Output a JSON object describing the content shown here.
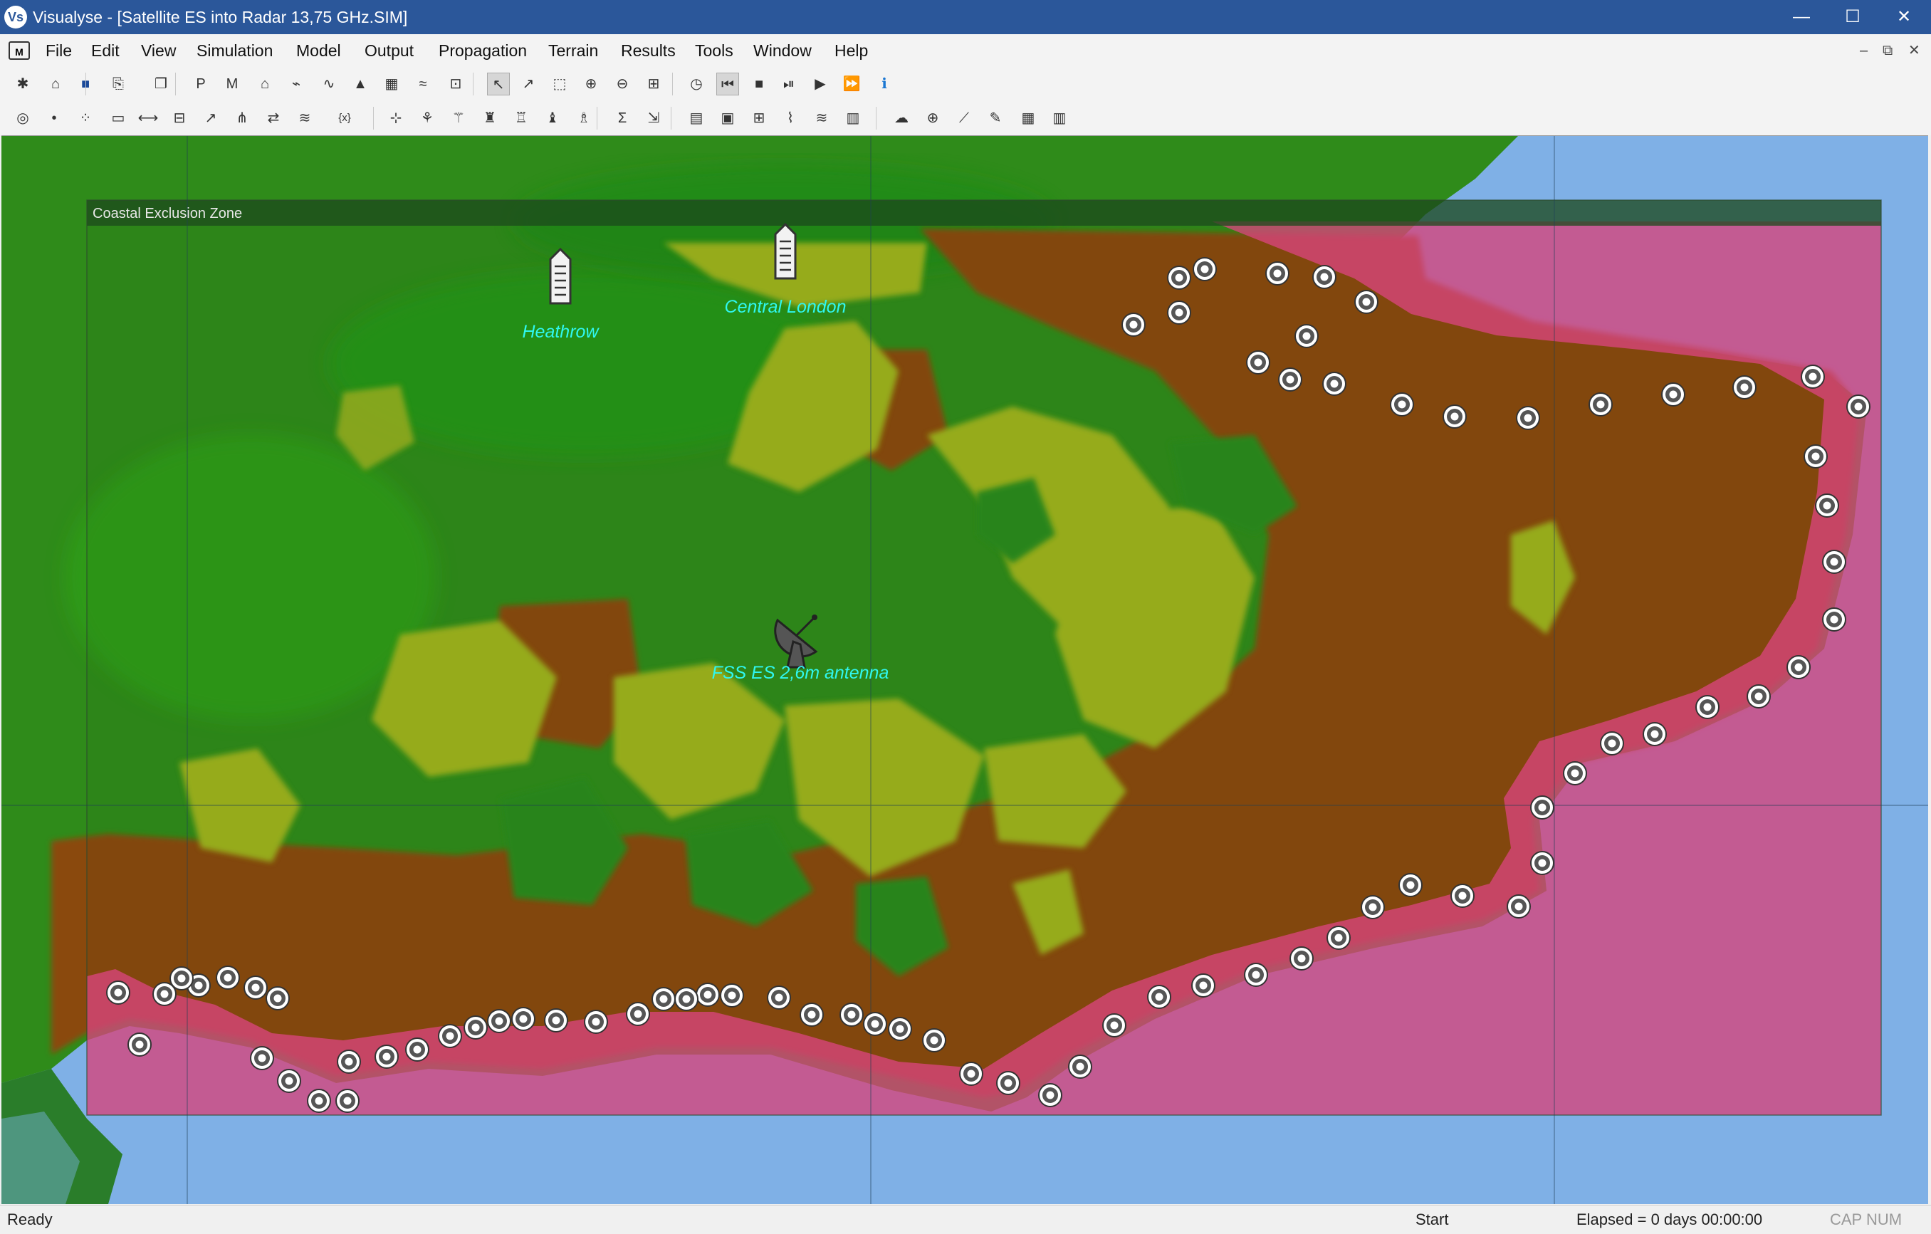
{
  "window": {
    "app_icon_text": "Vs",
    "title": "Visualyse - [Satellite ES into Radar 13,75 GHz.SIM]",
    "minimize_glyph": "—",
    "maximize_glyph": "☐",
    "close_glyph": "✕"
  },
  "menubar": {
    "doc_icon_text": "M",
    "items": [
      "File",
      "Edit",
      "View",
      "Simulation",
      "Model",
      "Output",
      "Propagation",
      "Terrain",
      "Results",
      "Tools",
      "Window",
      "Help"
    ],
    "mdi_minimize": "–",
    "mdi_restore": "⧉",
    "mdi_close": "✕"
  },
  "toolbar1": {
    "icons": [
      {
        "name": "new-file-icon",
        "glyph": "✱"
      },
      {
        "name": "open-file-icon",
        "glyph": "⌂"
      },
      {
        "name": "save-icon",
        "glyph": "■"
      },
      {
        "name": "save-as-icon",
        "glyph": "⎘"
      },
      {
        "name": "copy-icon",
        "glyph": "❐"
      },
      {
        "name": "station-p-icon",
        "glyph": "P"
      },
      {
        "name": "station-m-icon",
        "glyph": "M"
      },
      {
        "name": "station-earth-icon",
        "glyph": "⌂"
      },
      {
        "name": "station-link-icon",
        "glyph": "⌁"
      },
      {
        "name": "station-orbit-icon",
        "glyph": "∿"
      },
      {
        "name": "terrain-profile-icon",
        "glyph": "▲"
      },
      {
        "name": "table-icon",
        "glyph": "▦"
      },
      {
        "name": "area-analysis-icon",
        "glyph": "≈"
      },
      {
        "name": "map-view-icon",
        "glyph": "⊡"
      },
      {
        "name": "select-pointer-icon",
        "glyph": "↖"
      },
      {
        "name": "select-multi-icon",
        "glyph": "↗"
      },
      {
        "name": "select-area-icon",
        "glyph": "⬚"
      },
      {
        "name": "zoom-in-icon",
        "glyph": "⊕"
      },
      {
        "name": "zoom-out-icon",
        "glyph": "⊖"
      },
      {
        "name": "zoom-100-icon",
        "glyph": "⊞"
      },
      {
        "name": "clock-icon",
        "glyph": "◷"
      },
      {
        "name": "rewind-icon",
        "glyph": "⏮"
      },
      {
        "name": "stop-icon",
        "glyph": "■"
      },
      {
        "name": "step-icon",
        "glyph": "⏯"
      },
      {
        "name": "play-icon",
        "glyph": "▶"
      },
      {
        "name": "fast-forward-icon",
        "glyph": "⏩"
      },
      {
        "name": "info-icon",
        "glyph": "ℹ"
      }
    ]
  },
  "toolbar2": {
    "icons": [
      {
        "name": "antenna-icon",
        "glyph": "◎"
      },
      {
        "name": "point-icon",
        "glyph": "•"
      },
      {
        "name": "point-grid-icon",
        "glyph": "⁘"
      },
      {
        "name": "area-rect-icon",
        "glyph": "▭"
      },
      {
        "name": "line-icon",
        "glyph": "⟷"
      },
      {
        "name": "link-bracket-icon",
        "glyph": "⊟"
      },
      {
        "name": "beam-icon",
        "glyph": "↗"
      },
      {
        "name": "network-icon",
        "glyph": "⋔"
      },
      {
        "name": "swap-icon",
        "glyph": "⇄"
      },
      {
        "name": "interference-icon",
        "glyph": "≋"
      },
      {
        "name": "variable-icon",
        "glyph": "{x}"
      },
      {
        "name": "add-station-icon",
        "glyph": "⊹"
      },
      {
        "name": "station-group-icon",
        "glyph": "⚘"
      },
      {
        "name": "station-list-icon",
        "glyph": "⚚"
      },
      {
        "name": "tower-icon",
        "glyph": "♜"
      },
      {
        "name": "tower-edit-icon",
        "glyph": "♖"
      },
      {
        "name": "tower-multi-icon",
        "glyph": "♝"
      },
      {
        "name": "tower-delete-icon",
        "glyph": "♗"
      },
      {
        "name": "sum-icon",
        "glyph": "Σ"
      },
      {
        "name": "export-icon",
        "glyph": "⇲"
      },
      {
        "name": "report-icon",
        "glyph": "▤"
      },
      {
        "name": "report-select-icon",
        "glyph": "▣"
      },
      {
        "name": "report-add-icon",
        "glyph": "⊞"
      },
      {
        "name": "graph-icon",
        "glyph": "⌇"
      },
      {
        "name": "graph-area-icon",
        "glyph": "≋"
      },
      {
        "name": "graph-bar-icon",
        "glyph": "▥"
      },
      {
        "name": "terrain-map-icon",
        "glyph": "☁"
      },
      {
        "name": "terrain-add-icon",
        "glyph": "⊕"
      },
      {
        "name": "path-profile-icon",
        "glyph": "⟋"
      },
      {
        "name": "path-edit-icon",
        "glyph": "✎"
      },
      {
        "name": "tiles-icon",
        "glyph": "▦"
      },
      {
        "name": "statistics-icon",
        "glyph": "▥"
      }
    ]
  },
  "map": {
    "zone_label": "Coastal Exclusion Zone",
    "stations": {
      "heathrow": "Heathrow",
      "central_london": "Central London",
      "fss_es": "FSS ES 2,6m antenna"
    },
    "colors": {
      "sea": "#7fb0e6",
      "land_high": "#2f8b1a",
      "land_mid": "#9fb31c",
      "land_low": "#8a4a10",
      "exclusion_zone": "#d9457d",
      "label": "#2ff7f0"
    }
  },
  "statusbar": {
    "ready": "Ready",
    "start": "Start",
    "elapsed": "Elapsed = 0 days 00:00:00",
    "keys": "CAP NUM"
  }
}
